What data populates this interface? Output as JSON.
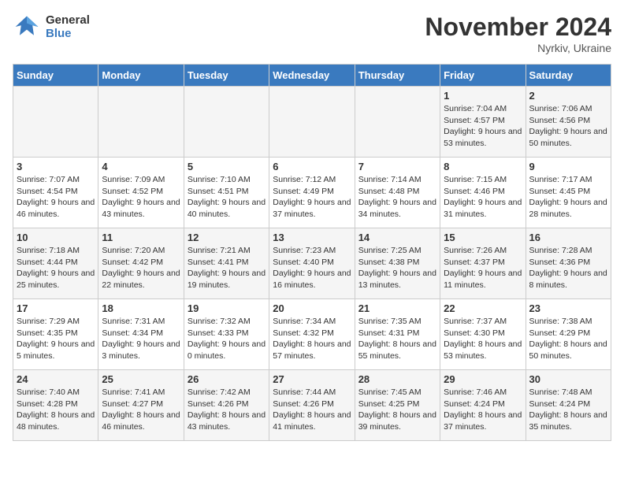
{
  "header": {
    "logo_line1": "General",
    "logo_line2": "Blue",
    "month_title": "November 2024",
    "subtitle": "Nyrkiv, Ukraine"
  },
  "days_of_week": [
    "Sunday",
    "Monday",
    "Tuesday",
    "Wednesday",
    "Thursday",
    "Friday",
    "Saturday"
  ],
  "weeks": [
    [
      {
        "num": "",
        "info": ""
      },
      {
        "num": "",
        "info": ""
      },
      {
        "num": "",
        "info": ""
      },
      {
        "num": "",
        "info": ""
      },
      {
        "num": "",
        "info": ""
      },
      {
        "num": "1",
        "info": "Sunrise: 7:04 AM\nSunset: 4:57 PM\nDaylight: 9 hours and 53 minutes."
      },
      {
        "num": "2",
        "info": "Sunrise: 7:06 AM\nSunset: 4:56 PM\nDaylight: 9 hours and 50 minutes."
      }
    ],
    [
      {
        "num": "3",
        "info": "Sunrise: 7:07 AM\nSunset: 4:54 PM\nDaylight: 9 hours and 46 minutes."
      },
      {
        "num": "4",
        "info": "Sunrise: 7:09 AM\nSunset: 4:52 PM\nDaylight: 9 hours and 43 minutes."
      },
      {
        "num": "5",
        "info": "Sunrise: 7:10 AM\nSunset: 4:51 PM\nDaylight: 9 hours and 40 minutes."
      },
      {
        "num": "6",
        "info": "Sunrise: 7:12 AM\nSunset: 4:49 PM\nDaylight: 9 hours and 37 minutes."
      },
      {
        "num": "7",
        "info": "Sunrise: 7:14 AM\nSunset: 4:48 PM\nDaylight: 9 hours and 34 minutes."
      },
      {
        "num": "8",
        "info": "Sunrise: 7:15 AM\nSunset: 4:46 PM\nDaylight: 9 hours and 31 minutes."
      },
      {
        "num": "9",
        "info": "Sunrise: 7:17 AM\nSunset: 4:45 PM\nDaylight: 9 hours and 28 minutes."
      }
    ],
    [
      {
        "num": "10",
        "info": "Sunrise: 7:18 AM\nSunset: 4:44 PM\nDaylight: 9 hours and 25 minutes."
      },
      {
        "num": "11",
        "info": "Sunrise: 7:20 AM\nSunset: 4:42 PM\nDaylight: 9 hours and 22 minutes."
      },
      {
        "num": "12",
        "info": "Sunrise: 7:21 AM\nSunset: 4:41 PM\nDaylight: 9 hours and 19 minutes."
      },
      {
        "num": "13",
        "info": "Sunrise: 7:23 AM\nSunset: 4:40 PM\nDaylight: 9 hours and 16 minutes."
      },
      {
        "num": "14",
        "info": "Sunrise: 7:25 AM\nSunset: 4:38 PM\nDaylight: 9 hours and 13 minutes."
      },
      {
        "num": "15",
        "info": "Sunrise: 7:26 AM\nSunset: 4:37 PM\nDaylight: 9 hours and 11 minutes."
      },
      {
        "num": "16",
        "info": "Sunrise: 7:28 AM\nSunset: 4:36 PM\nDaylight: 9 hours and 8 minutes."
      }
    ],
    [
      {
        "num": "17",
        "info": "Sunrise: 7:29 AM\nSunset: 4:35 PM\nDaylight: 9 hours and 5 minutes."
      },
      {
        "num": "18",
        "info": "Sunrise: 7:31 AM\nSunset: 4:34 PM\nDaylight: 9 hours and 3 minutes."
      },
      {
        "num": "19",
        "info": "Sunrise: 7:32 AM\nSunset: 4:33 PM\nDaylight: 9 hours and 0 minutes."
      },
      {
        "num": "20",
        "info": "Sunrise: 7:34 AM\nSunset: 4:32 PM\nDaylight: 8 hours and 57 minutes."
      },
      {
        "num": "21",
        "info": "Sunrise: 7:35 AM\nSunset: 4:31 PM\nDaylight: 8 hours and 55 minutes."
      },
      {
        "num": "22",
        "info": "Sunrise: 7:37 AM\nSunset: 4:30 PM\nDaylight: 8 hours and 53 minutes."
      },
      {
        "num": "23",
        "info": "Sunrise: 7:38 AM\nSunset: 4:29 PM\nDaylight: 8 hours and 50 minutes."
      }
    ],
    [
      {
        "num": "24",
        "info": "Sunrise: 7:40 AM\nSunset: 4:28 PM\nDaylight: 8 hours and 48 minutes."
      },
      {
        "num": "25",
        "info": "Sunrise: 7:41 AM\nSunset: 4:27 PM\nDaylight: 8 hours and 46 minutes."
      },
      {
        "num": "26",
        "info": "Sunrise: 7:42 AM\nSunset: 4:26 PM\nDaylight: 8 hours and 43 minutes."
      },
      {
        "num": "27",
        "info": "Sunrise: 7:44 AM\nSunset: 4:26 PM\nDaylight: 8 hours and 41 minutes."
      },
      {
        "num": "28",
        "info": "Sunrise: 7:45 AM\nSunset: 4:25 PM\nDaylight: 8 hours and 39 minutes."
      },
      {
        "num": "29",
        "info": "Sunrise: 7:46 AM\nSunset: 4:24 PM\nDaylight: 8 hours and 37 minutes."
      },
      {
        "num": "30",
        "info": "Sunrise: 7:48 AM\nSunset: 4:24 PM\nDaylight: 8 hours and 35 minutes."
      }
    ]
  ]
}
